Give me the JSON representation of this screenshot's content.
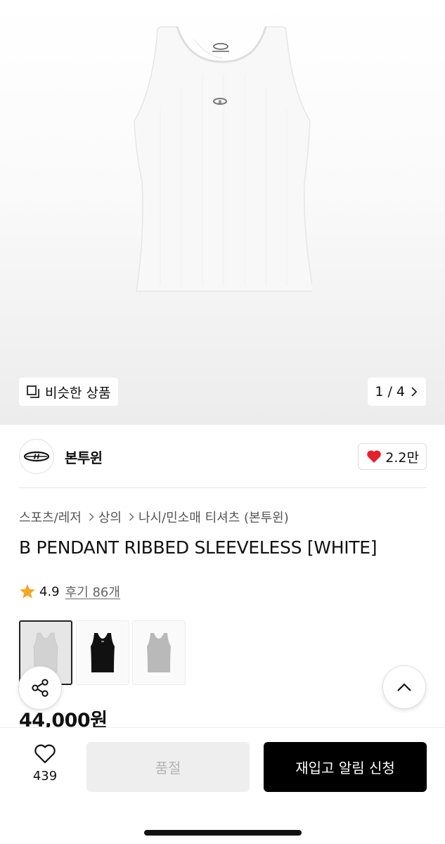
{
  "gallery": {
    "similar_label": "비슷한 상품",
    "pager": "1 / 4"
  },
  "brand": {
    "name": "본투윈",
    "likes": "2.2만"
  },
  "breadcrumb": [
    "스포츠/레저",
    "상의",
    "나시/민소매 티셔츠 (본투윈)"
  ],
  "product": {
    "title": "B PENDANT RIBBED SLEEVELESS [WHITE]",
    "rating": "4.9",
    "reviews": "후기 86개",
    "price": "44,000원",
    "options": [
      {
        "color": "white",
        "selected": true
      },
      {
        "color": "black",
        "selected": false
      },
      {
        "color": "grey",
        "selected": false
      }
    ]
  },
  "bottom_bar": {
    "wish_count": "439",
    "soldout_label": "품절",
    "notify_label": "재입고 알림 신청"
  },
  "colors": {
    "accent_heart": "#e8202a",
    "star": "#f5a623",
    "primary_button": "#000000",
    "disabled_button": "#eeeeee"
  },
  "icons": [
    "copy-icon",
    "chevron-right-icon",
    "heart-filled-icon",
    "star-icon",
    "share-icon",
    "chevron-up-icon",
    "heart-outline-icon"
  ]
}
